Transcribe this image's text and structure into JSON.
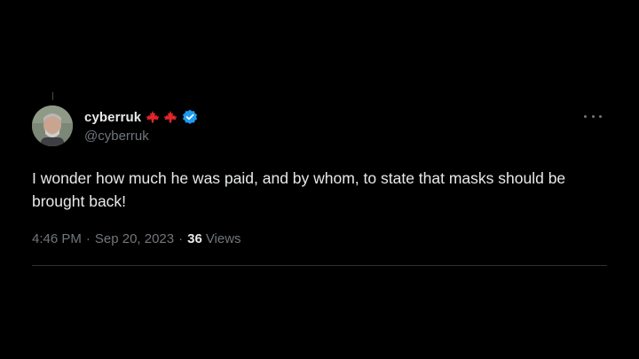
{
  "tweet": {
    "author": {
      "display_name": "cyberruk",
      "handle": "@cyberruk",
      "flag_icons": [
        "canada-flag-icon",
        "canada-flag-icon"
      ],
      "verified": true,
      "avatar": "user-avatar"
    },
    "text": "I wonder how much he was paid, and by whom, to state that masks should be brought back!",
    "time": "4:46 PM",
    "date": "Sep 20, 2023",
    "separator": "·",
    "views_count": "36",
    "views_label": "Views",
    "more_icon": "more-horizontal-icon"
  },
  "colors": {
    "background": "#000000",
    "text_primary": "#e7e9ea",
    "text_secondary": "#71767b",
    "verified_blue": "#1d9bf0",
    "flag_red": "#e0262a",
    "divider": "#2f3336"
  }
}
